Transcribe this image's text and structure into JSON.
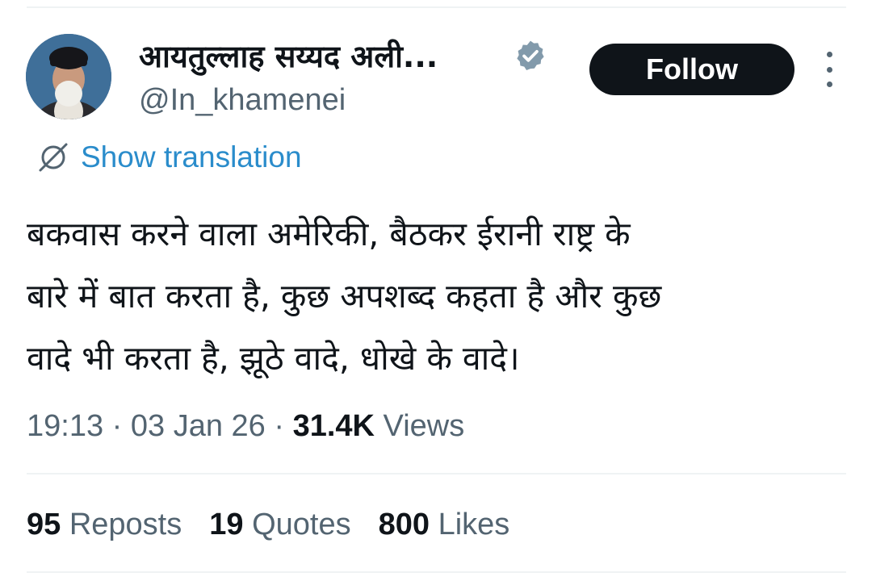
{
  "author": {
    "display_name": "आयतुल्लाह सय्यद अली...",
    "handle": "@In_khamenei",
    "verified_icon": "verified-badge-icon",
    "verified_color": "#829aab"
  },
  "actions": {
    "follow_label": "Follow",
    "more_icon": "more-vertical-icon"
  },
  "translation": {
    "icon": "globe-slash-icon",
    "label": "Show translation"
  },
  "tweet": {
    "lines": [
      "बकवास करने वाला अमेरिकी, बैठकर ईरानी राष्ट्र के",
      "बारे में बात करता है, कुछ अपशब्द कहता है और कुछ",
      "वादे भी करता है, झूठे वादे, धोखे के वादे।"
    ]
  },
  "meta": {
    "time": "19:13",
    "separator1": " · ",
    "date": "03 Jan 26",
    "separator2": " · ",
    "views_count": "31.4K",
    "views_label": " Views"
  },
  "stats": {
    "reposts_count": "95",
    "reposts_label": " Reposts",
    "quotes_count": "19",
    "quotes_label": " Quotes",
    "likes_count": "800",
    "likes_label": " Likes"
  },
  "colors": {
    "text_primary": "#0f1419",
    "text_secondary": "#536471",
    "link": "#2a8ccb",
    "button_bg": "#0f1419"
  }
}
